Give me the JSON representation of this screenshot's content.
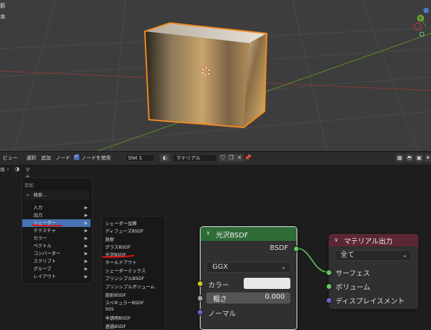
{
  "viewport": {
    "left_labels": [
      "影",
      "本"
    ]
  },
  "header": {
    "menu": [
      "ビュー",
      "選択",
      "追加",
      "ノード"
    ],
    "use_nodes_label": "ノードを使用",
    "slot": "Slot 1",
    "material_name": "マテリアル"
  },
  "breadcrumb": {
    "prefix": "体",
    "material": "マテリアル"
  },
  "add_menu": {
    "title": "追加",
    "search_placeholder": "検索...",
    "items": [
      "入力",
      "出力",
      "シェーダー",
      "テクスチャ",
      "カラー",
      "ベクトル",
      "コンバーター",
      "スクリプト",
      "グループ",
      "レイアウト"
    ]
  },
  "shader_submenu": {
    "items": [
      "シェーダー加算",
      "ディフューズBSDF",
      "放射",
      "グラスBSDF",
      "光沢BSDF",
      "ホールドアウト",
      "シェーダーミックス",
      "プリンシプルBSDF",
      "プリンシプルボリューム",
      "屈折BSDF",
      "スペキュラーBSDF",
      "SSS",
      "半透明BSDF",
      "透過BSDF"
    ]
  },
  "glossy_node": {
    "title": "光沢BSDF",
    "output": "BSDF",
    "distribution": "GGX",
    "color_label": "カラー",
    "roughness_label": "粗さ",
    "roughness_value": "0.000",
    "normal_label": "ノーマル"
  },
  "output_node": {
    "title": "マテリアル出力",
    "target": "全て",
    "inputs": [
      "サーフェス",
      "ボリューム",
      "ディスプレイスメント"
    ]
  },
  "colors": {
    "selection_orange": "#f08a25",
    "active_blue": "#4772b3",
    "annotation_red": "#e01010",
    "shader_header": "#2f6b37",
    "output_header": "#5a2733",
    "shader_socket": "#62c75d",
    "color_socket": "#c7c729",
    "float_socket": "#a1a1a1",
    "vector_socket": "#6363c7"
  }
}
